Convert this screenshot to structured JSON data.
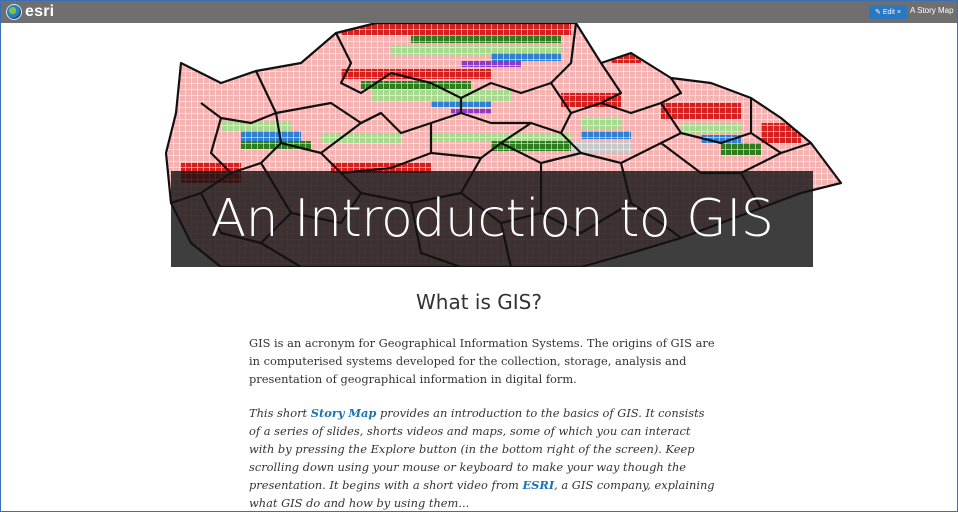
{
  "topbar": {
    "logo_text": "esri",
    "edit_label": "Edit",
    "story_title": "A Story Map"
  },
  "hero": {
    "title": "An Introduction to GIS",
    "map_colors": {
      "light_red": "#f3b3b3",
      "red": "#d62020",
      "dark_green": "#2e7d1e",
      "light_green": "#a9d890",
      "blue": "#2f7fd3",
      "purple": "#8a3cc8",
      "grey": "#c8c8c8",
      "border": "#111111"
    }
  },
  "section": {
    "heading": "What is GIS?"
  },
  "body": {
    "p1": "GIS is an acronym for Geographical Information Systems. The origins of GIS are in computerised systems developed for the collection, storage, analysis and presentation of geographical information in digital form.",
    "p2_a": "This short ",
    "p2_link1": "Story Map",
    "p2_b": " provides an introduction to the basics of GIS. It consists of a series of slides, shorts videos and maps, some of which you can interact with by pressing the Explore button (in the bottom right of the screen). Keep scrolling down using your mouse or keyboard to make your way though the presentation. It begins with a short video from ",
    "p2_link2": "ESRI",
    "p2_c": ", a GIS company, explaining what GIS do and how by using them..."
  }
}
